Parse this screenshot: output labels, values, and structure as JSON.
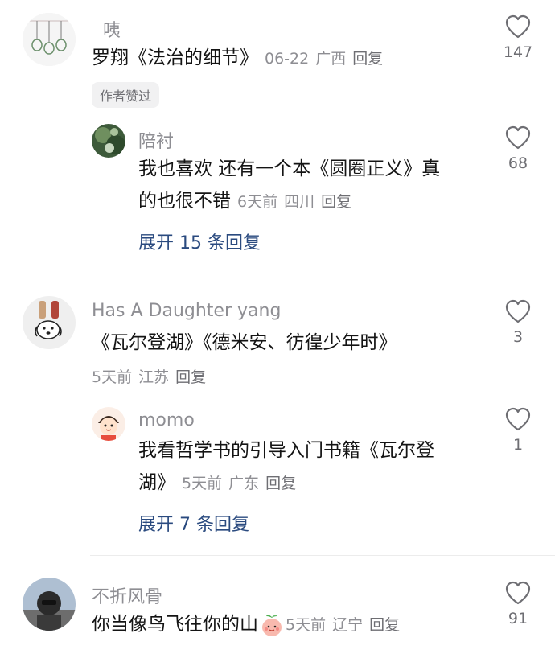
{
  "comments": [
    {
      "username": "咦",
      "text": "罗翔《法治的细节》",
      "date": "06-22",
      "location": "广西",
      "reply_label": "回复",
      "likes": "147",
      "badge": "作者赞过",
      "replies": [
        {
          "username": "陪衬",
          "text_line1": "我也喜欢 还有一个本《圆圈正义》真",
          "text_line2": "的也很不错",
          "date": "6天前",
          "location": "四川",
          "reply_label": "回复",
          "likes": "68"
        }
      ],
      "expand_label": "展开 15 条回复"
    },
    {
      "username": "Has  A Daughter yang",
      "text": "《瓦尔登湖》《德米安、彷徨少年时》",
      "date": "5天前",
      "location": "江苏",
      "reply_label": "回复",
      "likes": "3",
      "replies": [
        {
          "username": "momo",
          "text_line1": "我看哲学书的引导入门书籍《瓦尔登",
          "text_line2": "湖》",
          "date": "5天前",
          "location": "广东",
          "reply_label": "回复",
          "likes": "1"
        }
      ],
      "expand_label": "展开 7 条回复"
    },
    {
      "username": "不折风骨",
      "text": "你当像鸟飞往你的山",
      "date": "5天前",
      "location": "辽宁",
      "reply_label": "回复",
      "likes": "91",
      "emoji": "peach-face-emoji"
    }
  ],
  "colors": {
    "link": "#2a4a7f",
    "muted": "#8e8e93",
    "text": "#141414"
  }
}
